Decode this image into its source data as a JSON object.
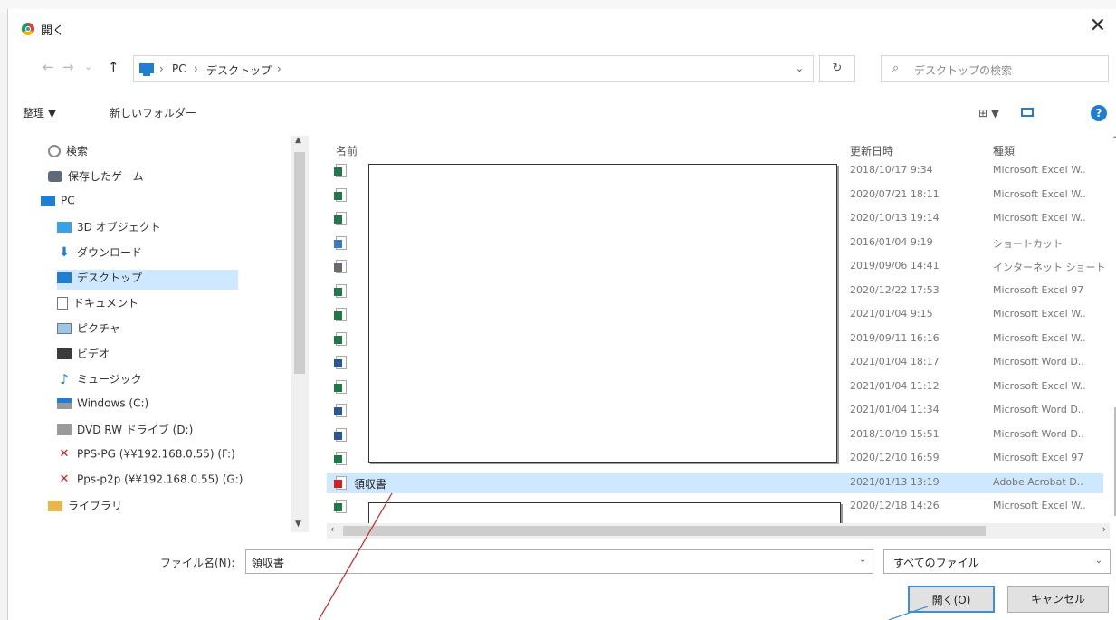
{
  "window": {
    "title": "開く"
  },
  "nav": {
    "back": "←",
    "forward": "→",
    "recent": "⌄",
    "up": "↑",
    "crumbs": [
      "PC",
      "デスクトップ"
    ],
    "refresh": "↻",
    "search_placeholder": "デスクトップの検索"
  },
  "toolbar": {
    "organize": "整理 ▼",
    "new_folder": "新しいフォルダー",
    "view": "⊞ ▼",
    "help": "?"
  },
  "sidebar": {
    "items": [
      {
        "label": "検索",
        "icon": "search-icon"
      },
      {
        "label": "保存したゲーム",
        "icon": "game-icon"
      },
      {
        "label": "PC",
        "icon": "pc-icon"
      },
      {
        "label": "3D オブジェクト",
        "icon": "3d-object-icon"
      },
      {
        "label": "ダウンロード",
        "icon": "download-icon"
      },
      {
        "label": "デスクトップ",
        "icon": "desktop-icon"
      },
      {
        "label": "ドキュメント",
        "icon": "document-icon"
      },
      {
        "label": "ピクチャ",
        "icon": "picture-icon"
      },
      {
        "label": "ビデオ",
        "icon": "video-icon"
      },
      {
        "label": "ミュージック",
        "icon": "music-icon"
      },
      {
        "label": "Windows (C:)",
        "icon": "drive-icon"
      },
      {
        "label": "DVD RW ドライブ (D:)",
        "icon": "dvd-drive-icon"
      },
      {
        "label": "PPS-PG (¥¥192.168.0.55) (F:)",
        "icon": "network-drive-icon"
      },
      {
        "label": "Pps-p2p (¥¥192.168.0.55) (G:)",
        "icon": "network-drive-icon"
      },
      {
        "label": "ライブラリ",
        "icon": "library-icon"
      }
    ]
  },
  "columns": {
    "name": "名前",
    "date": "更新日時",
    "type": "種類"
  },
  "files": [
    {
      "name": "",
      "date": "2018/10/17 9:34",
      "type": "Microsoft Excel W..",
      "icon": "excel-icon"
    },
    {
      "name": "",
      "date": "2020/07/21 18:11",
      "type": "Microsoft Excel W..",
      "icon": "excel-icon"
    },
    {
      "name": "",
      "date": "2020/10/13 19:14",
      "type": "Microsoft Excel W..",
      "icon": "excel-icon"
    },
    {
      "name": "",
      "date": "2016/01/04 9:19",
      "type": "ショートカット",
      "icon": "shortcut-icon"
    },
    {
      "name": "",
      "date": "2019/09/06 14:41",
      "type": "インターネット ショート",
      "icon": "internet-shortcut-icon"
    },
    {
      "name": "",
      "date": "2020/12/22 17:53",
      "type": "Microsoft Excel 97",
      "icon": "excel97-icon"
    },
    {
      "name": "",
      "date": "2021/01/04 9:15",
      "type": "Microsoft Excel W..",
      "icon": "excel-icon"
    },
    {
      "name": "",
      "date": "2019/09/11 16:16",
      "type": "Microsoft Excel W..",
      "icon": "excel-icon"
    },
    {
      "name": "",
      "date": "2021/01/04 18:17",
      "type": "Microsoft Word D..",
      "icon": "word-icon"
    },
    {
      "name": "",
      "date": "2021/01/04 11:12",
      "type": "Microsoft Excel W..",
      "icon": "excel-icon"
    },
    {
      "name": "",
      "date": "2021/01/04 11:34",
      "type": "Microsoft Word D..",
      "icon": "word-icon"
    },
    {
      "name": "",
      "date": "2018/10/19 15:51",
      "type": "Microsoft Word D..",
      "icon": "word-icon"
    },
    {
      "name": "",
      "date": "2020/12/10 16:59",
      "type": "Microsoft Excel 97",
      "icon": "excel97-icon"
    },
    {
      "name": "領収書",
      "date": "2021/01/13 13:19",
      "type": "Adobe Acrobat D..",
      "icon": "pdf-icon"
    },
    {
      "name": "",
      "date": "2020/12/18 14:26",
      "type": "Microsoft Excel W..",
      "icon": "excel-icon"
    }
  ],
  "footer": {
    "filename_label": "ファイル名(N):",
    "filename_value": "領収書",
    "filter_value": "すべてのファイル",
    "open_button": "開く(O)",
    "cancel_button": "キャンセル"
  },
  "colors": {
    "accent": "#1f7ed2",
    "selection": "#cde8ff",
    "annotation": "#d22020"
  }
}
